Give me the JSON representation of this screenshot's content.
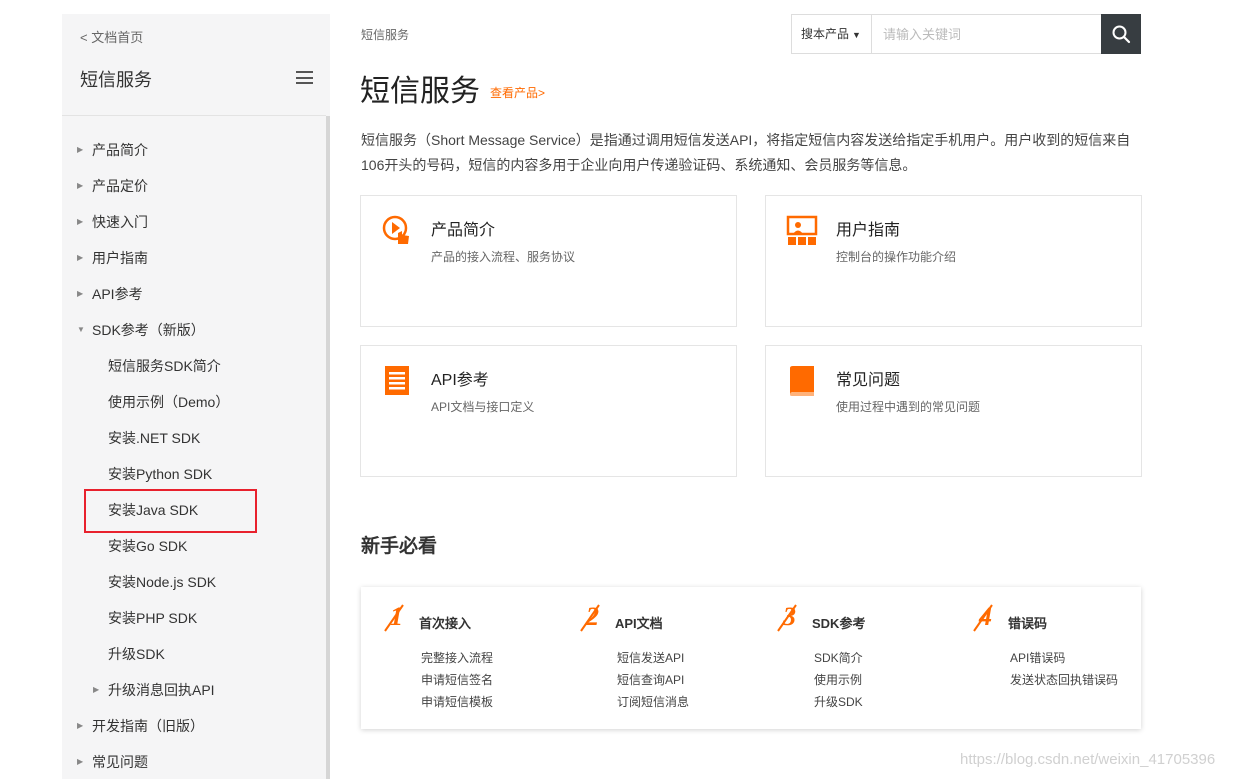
{
  "sidebar": {
    "back_link": "< 文档首页",
    "title": "短信服务",
    "items": [
      {
        "label": "产品简介",
        "level": 0,
        "caret": "▶"
      },
      {
        "label": "产品定价",
        "level": 0,
        "caret": "▶"
      },
      {
        "label": "快速入门",
        "level": 0,
        "caret": "▶"
      },
      {
        "label": "用户指南",
        "level": 0,
        "caret": "▶"
      },
      {
        "label": "API参考",
        "level": 0,
        "caret": "▶"
      },
      {
        "label": "SDK参考（新版）",
        "level": 0,
        "caret": "▼"
      },
      {
        "label": "短信服务SDK简介",
        "level": 1,
        "caret": ""
      },
      {
        "label": "使用示例（Demo）",
        "level": 1,
        "caret": ""
      },
      {
        "label": "安装.NET SDK",
        "level": 1,
        "caret": ""
      },
      {
        "label": "安装Python SDK",
        "level": 1,
        "caret": ""
      },
      {
        "label": "安装Java SDK",
        "level": 1,
        "caret": ""
      },
      {
        "label": "安装Go SDK",
        "level": 1,
        "caret": ""
      },
      {
        "label": "安装Node.js SDK",
        "level": 1,
        "caret": ""
      },
      {
        "label": "安装PHP SDK",
        "level": 1,
        "caret": ""
      },
      {
        "label": "升级SDK",
        "level": 1,
        "caret": ""
      },
      {
        "label": "升级消息回执API",
        "level": 1,
        "caret": "▶"
      },
      {
        "label": "开发指南（旧版）",
        "level": 0,
        "caret": "▶"
      },
      {
        "label": "常见问题",
        "level": 0,
        "caret": "▶"
      }
    ]
  },
  "header": {
    "breadcrumb": "短信服务",
    "search": {
      "scope": "搜本产品",
      "placeholder": "请输入关键词"
    }
  },
  "main": {
    "title": "短信服务",
    "view_product": "查看产品>",
    "intro": "短信服务（Short Message Service）是指通过调用短信发送API，将指定短信内容发送给指定手机用户。用户收到的短信来自106开头的号码，短信的内容多用于企业向用户传递验证码、系统通知、会员服务等信息。",
    "cards": [
      {
        "title": "产品简介",
        "desc": "产品的接入流程、服务协议",
        "icon": "play-hand-icon"
      },
      {
        "title": "用户指南",
        "desc": "控制台的操作功能介绍",
        "icon": "presentation-icon"
      },
      {
        "title": "API参考",
        "desc": "API文档与接口定义",
        "icon": "document-icon"
      },
      {
        "title": "常见问题",
        "desc": "使用过程中遇到的常见问题",
        "icon": "book-icon"
      }
    ],
    "section_title": "新手必看",
    "guide": [
      {
        "num": "1",
        "title": "首次接入",
        "links": [
          "完整接入流程",
          "申请短信签名",
          "申请短信模板"
        ]
      },
      {
        "num": "2",
        "title": "API文档",
        "links": [
          "短信发送API",
          "短信查询API",
          "订阅短信消息"
        ]
      },
      {
        "num": "3",
        "title": "SDK参考",
        "links": [
          "SDK简介",
          "使用示例",
          "升级SDK"
        ]
      },
      {
        "num": "4",
        "title": "错误码",
        "links": [
          "API错误码",
          "发送状态回执错误码"
        ]
      }
    ]
  },
  "watermark": "https://blog.csdn.net/weixin_41705396",
  "colors": {
    "accent": "#ff6a00",
    "highlight_border": "#e8212d",
    "search_button": "#373d41"
  }
}
